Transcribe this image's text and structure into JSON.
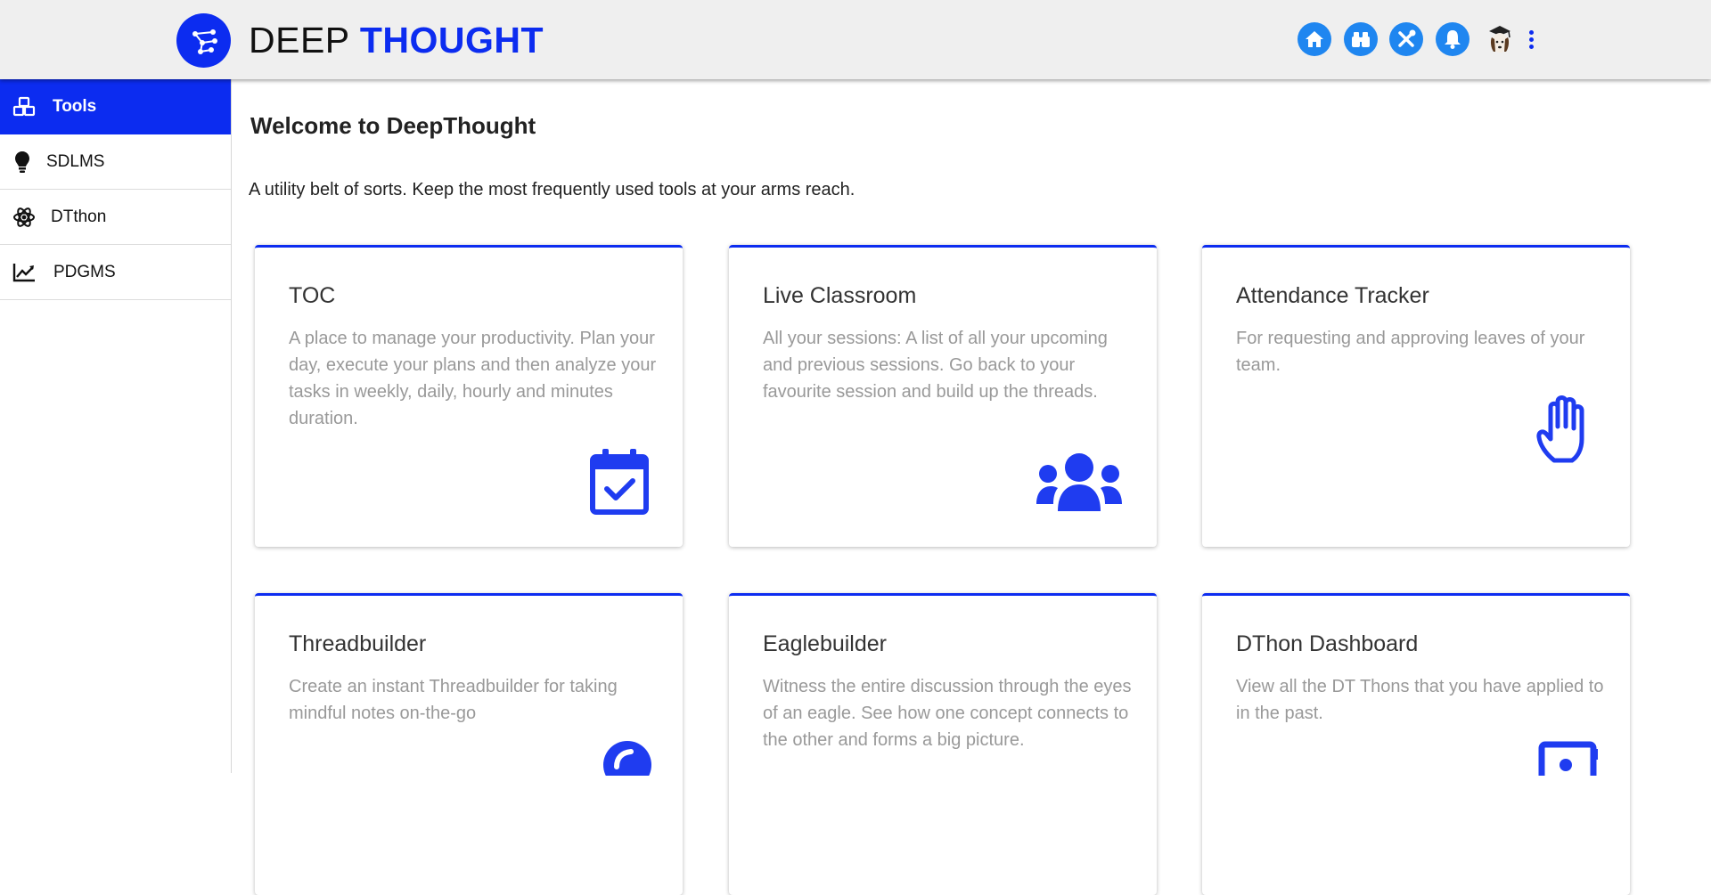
{
  "header": {
    "brand_part1": "DEEP",
    "brand_part2": "THOUGHT",
    "icons": [
      "home-icon",
      "binoculars-icon",
      "tools-icon",
      "bell-icon"
    ],
    "accent_color": "#0c2cf0",
    "icon_button_color": "#1f86f0"
  },
  "sidebar": {
    "items": [
      {
        "label": "Tools",
        "icon": "cubes-icon",
        "active": true
      },
      {
        "label": "SDLMS",
        "icon": "lightbulb-icon",
        "active": false
      },
      {
        "label": "DTthon",
        "icon": "atom-icon",
        "active": false
      },
      {
        "label": "PDGMS",
        "icon": "chart-line-icon",
        "active": false
      }
    ]
  },
  "main": {
    "title": "Welcome to DeepThought",
    "description": "A utility belt of sorts. Keep the most frequently used tools at your arms reach.",
    "cards": [
      {
        "title": "TOC",
        "description": "A place to manage your productivity. Plan your day, execute your plans and then analyze your tasks in weekly, daily, hourly and minutes duration.",
        "icon": "calendar-check-icon"
      },
      {
        "title": "Live Classroom",
        "description": "All your sessions: A list of all your upcoming and previous sessions. Go back to your favourite session and build up the threads.",
        "icon": "users-icon"
      },
      {
        "title": "Attendance Tracker",
        "description": "For requesting and approving leaves of your team.",
        "icon": "hand-icon"
      },
      {
        "title": "Threadbuilder",
        "description": "Create an instant Threadbuilder for taking mindful notes on-the-go",
        "icon": "spinner-icon"
      },
      {
        "title": "Eaglebuilder",
        "description": "Witness the entire discussion through the eyes of an eagle. See how one concept connects to the other and forms a big picture.",
        "icon": "eagle-icon"
      },
      {
        "title": "DThon Dashboard",
        "description": "View all the DT Thons that you have applied to in the past.",
        "icon": "vault-icon"
      }
    ]
  }
}
